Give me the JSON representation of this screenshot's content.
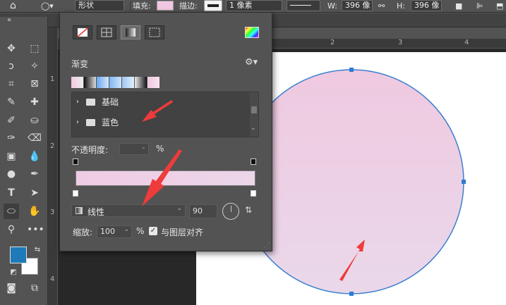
{
  "options_bar": {
    "shape_mode": "形状",
    "fill_label": "填充:",
    "stroke_label": "描边:",
    "stroke_width": "1 像素",
    "w_label": "W:",
    "w_value": "396 像",
    "h_label": "H:",
    "h_value": "396 像"
  },
  "rulers": {
    "top": [
      "2",
      "3",
      "4"
    ],
    "left": [
      "1",
      "2",
      "3",
      "4"
    ]
  },
  "gradient_panel": {
    "section_label": "渐变",
    "folders": [
      "基础",
      "蓝色"
    ],
    "opacity_label": "不透明度:",
    "opacity_unit": "%",
    "style_value": "线性",
    "angle_value": "90",
    "scale_label": "缩放:",
    "scale_value": "100",
    "scale_unit": "%",
    "align_label": "与图层对齐",
    "align_checked": true,
    "gradient_colors": [
      "#f0cce4",
      "#ecd6e8"
    ]
  },
  "colors": {
    "foreground": "#1e7ab8",
    "background": "#ffffff",
    "shape_fill": "#f0cde2",
    "shape_stroke": "#3a7fd0",
    "arrow": "#ee3b3b"
  }
}
